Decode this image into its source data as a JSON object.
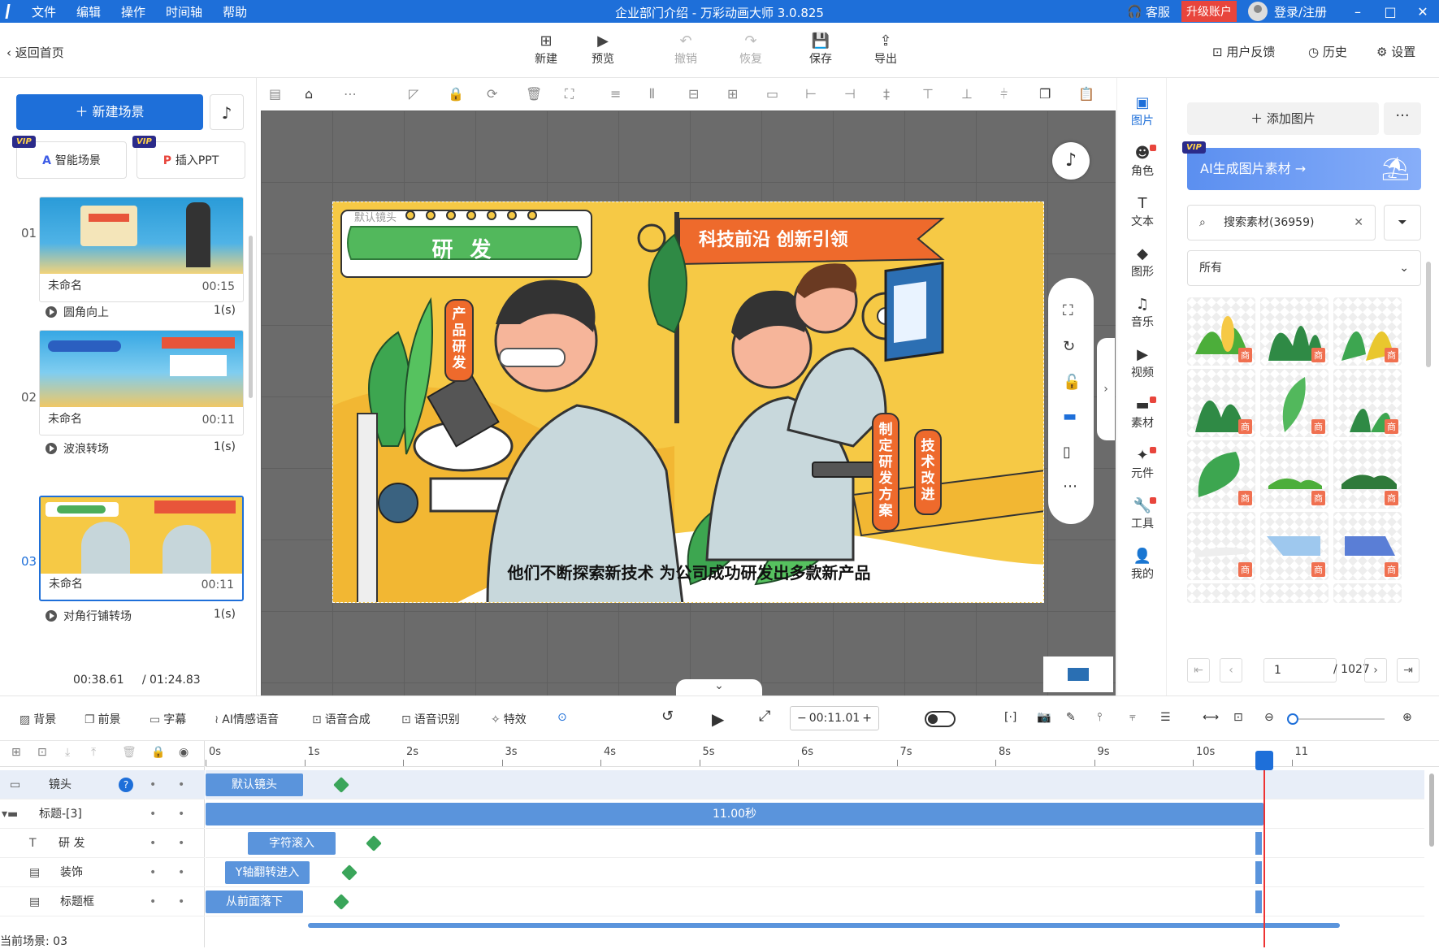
{
  "titlebar": {
    "menu": [
      "文件",
      "编辑",
      "操作",
      "时间轴",
      "帮助"
    ],
    "title": "企业部门介绍 - 万彩动画大师 3.0.825",
    "service": "客服",
    "upgrade": "升级账户",
    "login": "登录/注册",
    "win_minimize": "–",
    "win_maximize": "□",
    "win_close": "✕"
  },
  "toolbar": {
    "back": "返回首页",
    "buttons": [
      {
        "label": "新建",
        "icon": "new-icon",
        "glyph": "⊞",
        "enabled": true
      },
      {
        "label": "预览",
        "icon": "play-icon",
        "glyph": "▶",
        "enabled": true
      },
      {
        "label": "撤销",
        "icon": "undo-icon",
        "glyph": "↶",
        "enabled": false
      },
      {
        "label": "恢复",
        "icon": "redo-icon",
        "glyph": "↷",
        "enabled": false
      },
      {
        "label": "保存",
        "icon": "save-icon",
        "glyph": "💾",
        "enabled": true
      },
      {
        "label": "导出",
        "icon": "export-icon",
        "glyph": "⇪",
        "enabled": true
      }
    ],
    "feedback": "用户反馈",
    "history": "历史",
    "settings": "设置"
  },
  "left_panel": {
    "new_scene": "新建场景",
    "smart_scene": "智能场景",
    "insert_ppt": "插入PPT",
    "vip": "VIP",
    "scenes": [
      {
        "num": "01",
        "name": "未命名",
        "duration": "00:15",
        "transition": "圆角向上",
        "transition_time": "1(s)"
      },
      {
        "num": "02",
        "name": "未命名",
        "duration": "00:11",
        "transition": "波浪转场",
        "transition_time": "1(s)"
      },
      {
        "num": "03",
        "name": "未命名",
        "duration": "00:11",
        "transition": "对角行铺转场",
        "transition_time": "1(s)"
      }
    ],
    "current_time": "00:38.61",
    "total_time": "/ 01:24.83"
  },
  "canvas": {
    "default_lens": "默认镜头",
    "banner_title": "研 发",
    "flag_text": "科技前沿 创新引领",
    "tag_product": "产品研发",
    "tag_plan": "制定研发方案",
    "tag_tech": "技术改进",
    "subtitle": "他们不断探索新技术 为公司成功研发出多款新产品"
  },
  "right_nav": [
    {
      "label": "图片",
      "icon": "image-icon",
      "glyph": "▣",
      "active": true,
      "dot": false
    },
    {
      "label": "角色",
      "icon": "character-icon",
      "glyph": "☻",
      "active": false,
      "dot": true
    },
    {
      "label": "文本",
      "icon": "text-icon",
      "glyph": "T",
      "active": false,
      "dot": false
    },
    {
      "label": "图形",
      "icon": "shape-icon",
      "glyph": "◆",
      "active": false,
      "dot": false
    },
    {
      "label": "音乐",
      "icon": "music-icon",
      "glyph": "♫",
      "active": false,
      "dot": false
    },
    {
      "label": "视频",
      "icon": "video-icon",
      "glyph": "▶",
      "active": false,
      "dot": false
    },
    {
      "label": "素材",
      "icon": "material-icon",
      "glyph": "▬",
      "active": false,
      "dot": true
    },
    {
      "label": "元件",
      "icon": "component-icon",
      "glyph": "✦",
      "active": false,
      "dot": true
    },
    {
      "label": "工具",
      "icon": "tool-icon",
      "glyph": "🔧",
      "active": false,
      "dot": true
    },
    {
      "label": "我的",
      "icon": "user-icon",
      "glyph": "👤",
      "active": false,
      "dot": false
    }
  ],
  "right_panel": {
    "add_image": "添加图片",
    "more": "···",
    "ai_banner": "AI生成图片素材 →",
    "search_placeholder": "搜索素材(36959)",
    "filter_all": "所有",
    "badge": "商",
    "page_current": "1",
    "page_total": "/ 1027"
  },
  "timeline_toolbar": {
    "tools": [
      "背景",
      "前景",
      "字幕",
      "AI情感语音",
      "语音合成",
      "语音识别",
      "特效"
    ],
    "time": "00:11.01",
    "minus": "−",
    "plus": "+"
  },
  "timeline": {
    "ruler": [
      "0s",
      "1s",
      "2s",
      "3s",
      "4s",
      "5s",
      "6s",
      "7s",
      "8s",
      "9s",
      "10s",
      "11"
    ],
    "tracks": [
      {
        "name": "镜头",
        "clip": "默认镜头"
      },
      {
        "name": "标题-[3]",
        "clip": "11.00秒"
      },
      {
        "name": "研 发",
        "clip": "字符滚入"
      },
      {
        "name": "装饰",
        "clip": "Y轴翻转进入"
      },
      {
        "name": "标题框",
        "clip": "从前面落下"
      }
    ],
    "current_scene": "当前场景: 03"
  },
  "colors": {
    "accent": "#1e6fd9",
    "upgrade": "#e8453c",
    "clip": "#5a94dc",
    "keyframe": "#3aa55a",
    "playhead": "#e33333"
  }
}
